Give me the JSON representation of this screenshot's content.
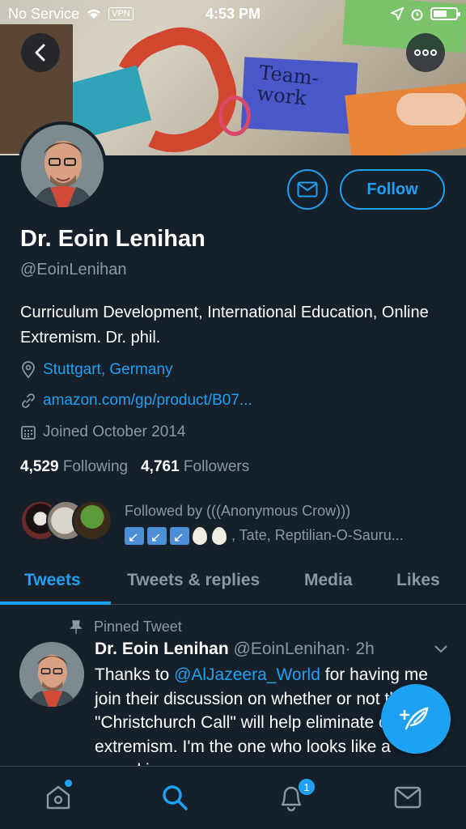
{
  "status_bar": {
    "carrier": "No Service",
    "vpn": "VPN",
    "time": "4:53 PM",
    "battery_level": 0.6
  },
  "header": {
    "banner_sign_text": "Team-\nwork"
  },
  "profile": {
    "follow_label": "Follow",
    "name": "Dr. Eoin Lenihan",
    "handle": "@EoinLenihan",
    "bio": "Curriculum Development, International Education, Online Extremism. Dr. phil.",
    "location": "Stuttgart, Germany",
    "website": "amazon.com/gp/product/B07...",
    "joined": "Joined October 2014",
    "following_count": "4,529",
    "following_label": "Following",
    "followers_count": "4,761",
    "followers_label": "Followers",
    "followed_by_line1": "Followed by (((Anonymous Crow)))",
    "followed_by_line2": ", Tate, Reptilian-O-Sauru..."
  },
  "tabs": [
    {
      "label": "Tweets",
      "active": true
    },
    {
      "label": "Tweets & replies",
      "active": false
    },
    {
      "label": "Media",
      "active": false
    },
    {
      "label": "Likes",
      "active": false
    }
  ],
  "tweet": {
    "pinned_label": "Pinned Tweet",
    "author_name": "Dr. Eoin Lenihan",
    "author_handle": "@EoinLenihan",
    "time_ago": "· 2h",
    "text_before": "Thanks to ",
    "mention": "@AlJazeera_World",
    "text_after": " for having me join their discussion on whether or not the \"Christchurch Call\" will help eliminate online extremism. I'm the one who looks like a pumpkin"
  },
  "bottom_nav": {
    "notification_count": "1"
  },
  "colors": {
    "background": "#15202b",
    "accent": "#1da1f2",
    "muted_text": "#8899a6",
    "divider": "#38444d"
  }
}
